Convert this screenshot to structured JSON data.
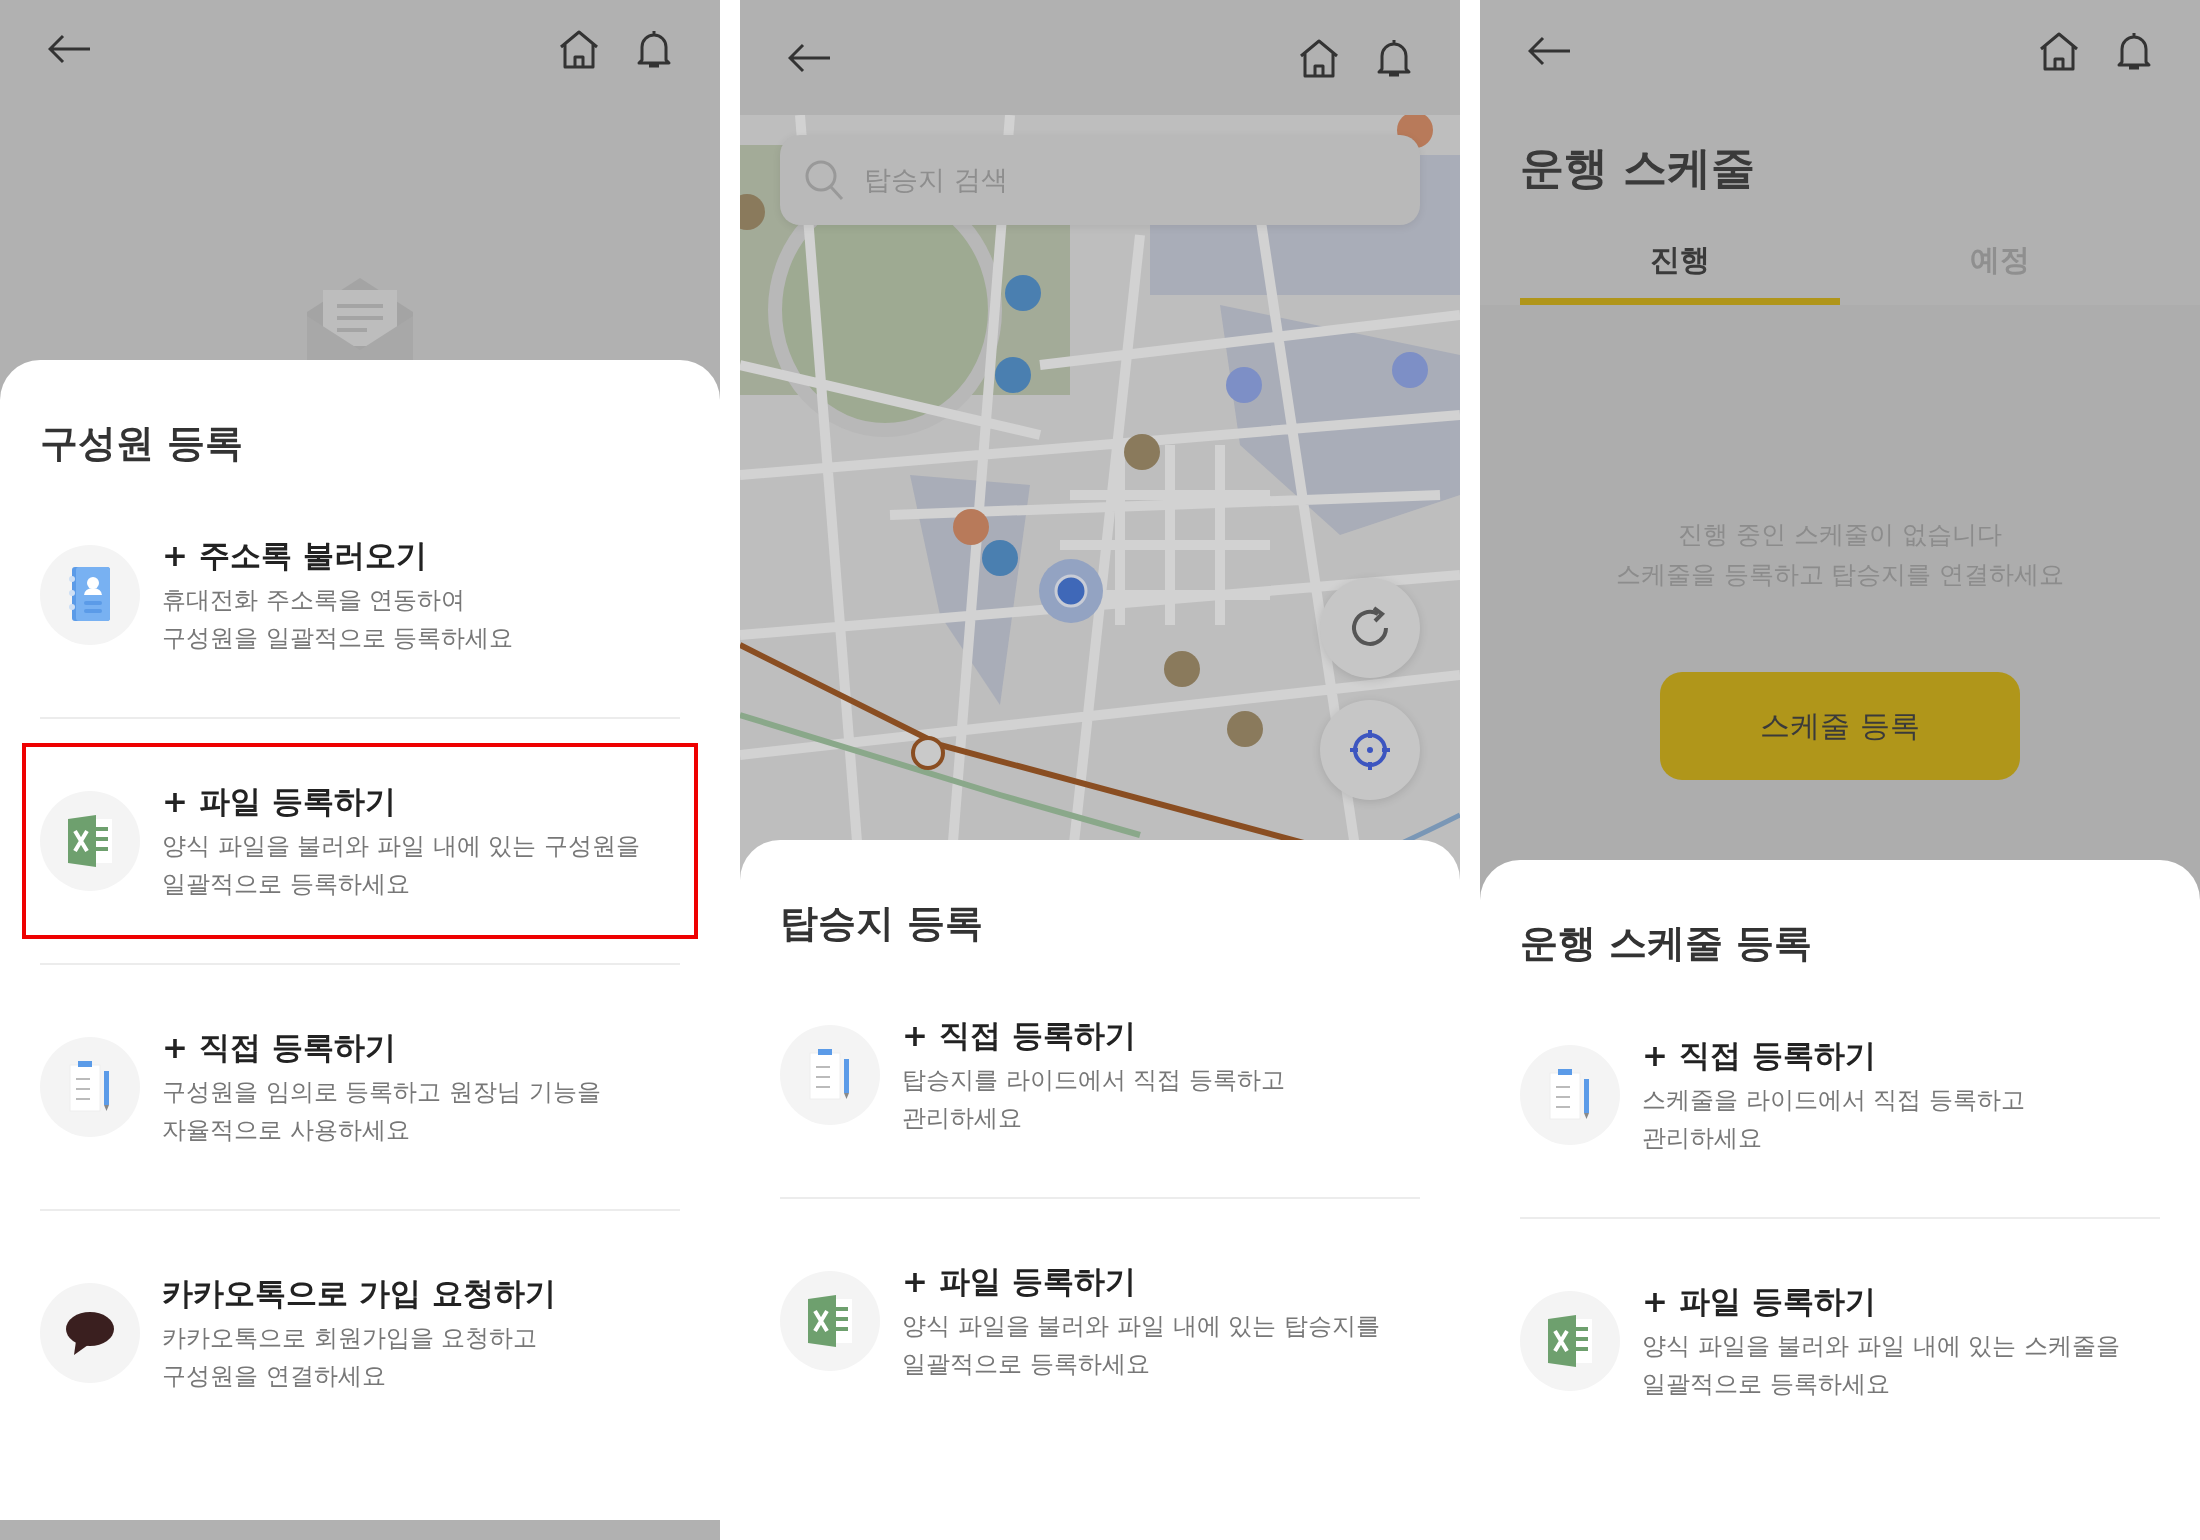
{
  "panels": [
    {
      "kind": "members",
      "sheet": {
        "title": "구성원 등록",
        "items": [
          {
            "kind": "contacts",
            "title": "+ 주소록 불러오기",
            "description": [
              "휴대전화 주소록을 연동하여",
              "구성원을 일괄적으로 등록하세요"
            ],
            "highlighted": false
          },
          {
            "kind": "excel",
            "title": "+ 파일 등록하기",
            "description": [
              "양식 파일을 불러와 파일 내에 있는 구성원을",
              "일괄적으로 등록하세요"
            ],
            "highlighted": true
          },
          {
            "kind": "memo",
            "title": "+ 직접 등록하기",
            "description": [
              "구성원을 임의로 등록하고 원장님 기능을",
              "자율적으로 사용하세요"
            ],
            "highlighted": false
          },
          {
            "kind": "chat",
            "title": "카카오톡으로 가입 요청하기",
            "description": [
              "카카오톡으로 회원가입을 요청하고",
              "구성원을 연결하세요"
            ],
            "highlighted": false
          }
        ]
      }
    },
    {
      "kind": "map",
      "search": {
        "placeholder": "탑승지 검색"
      },
      "sheet": {
        "title": "탑승지 등록",
        "items": [
          {
            "kind": "memo",
            "title": "+ 직접 등록하기",
            "description": [
              "탑승지를 라이드에서 직접 등록하고",
              "관리하세요"
            ],
            "highlighted": false
          },
          {
            "kind": "excel",
            "title": "+ 파일 등록하기",
            "description": [
              "양식 파일을 불러와 파일 내에 있는 탑승지를",
              "일괄적으로 등록하세요"
            ],
            "highlighted": false
          }
        ]
      }
    },
    {
      "kind": "schedule",
      "page_title": "운행 스케줄",
      "tabs": [
        {
          "label": "진행",
          "selected": true
        },
        {
          "label": "예정",
          "selected": false
        }
      ],
      "empty_message": [
        "진행 중인 스케줄이 없습니다",
        "스케줄을 등록하고 탑승지를 연결하세요"
      ],
      "button": "스케줄 등록",
      "sheet": {
        "title": "운행 스케줄 등록",
        "items": [
          {
            "kind": "memo",
            "title": "+ 직접 등록하기",
            "description": [
              "스케줄을 라이드에서 직접 등록하고",
              "관리하세요"
            ],
            "highlighted": false
          },
          {
            "kind": "excel",
            "title": "+ 파일 등록하기",
            "description": [
              "양식 파일을 불러와 파일 내에 있는 스케줄을",
              "일괄적으로 등록하세요"
            ],
            "highlighted": false
          }
        ]
      }
    }
  ]
}
